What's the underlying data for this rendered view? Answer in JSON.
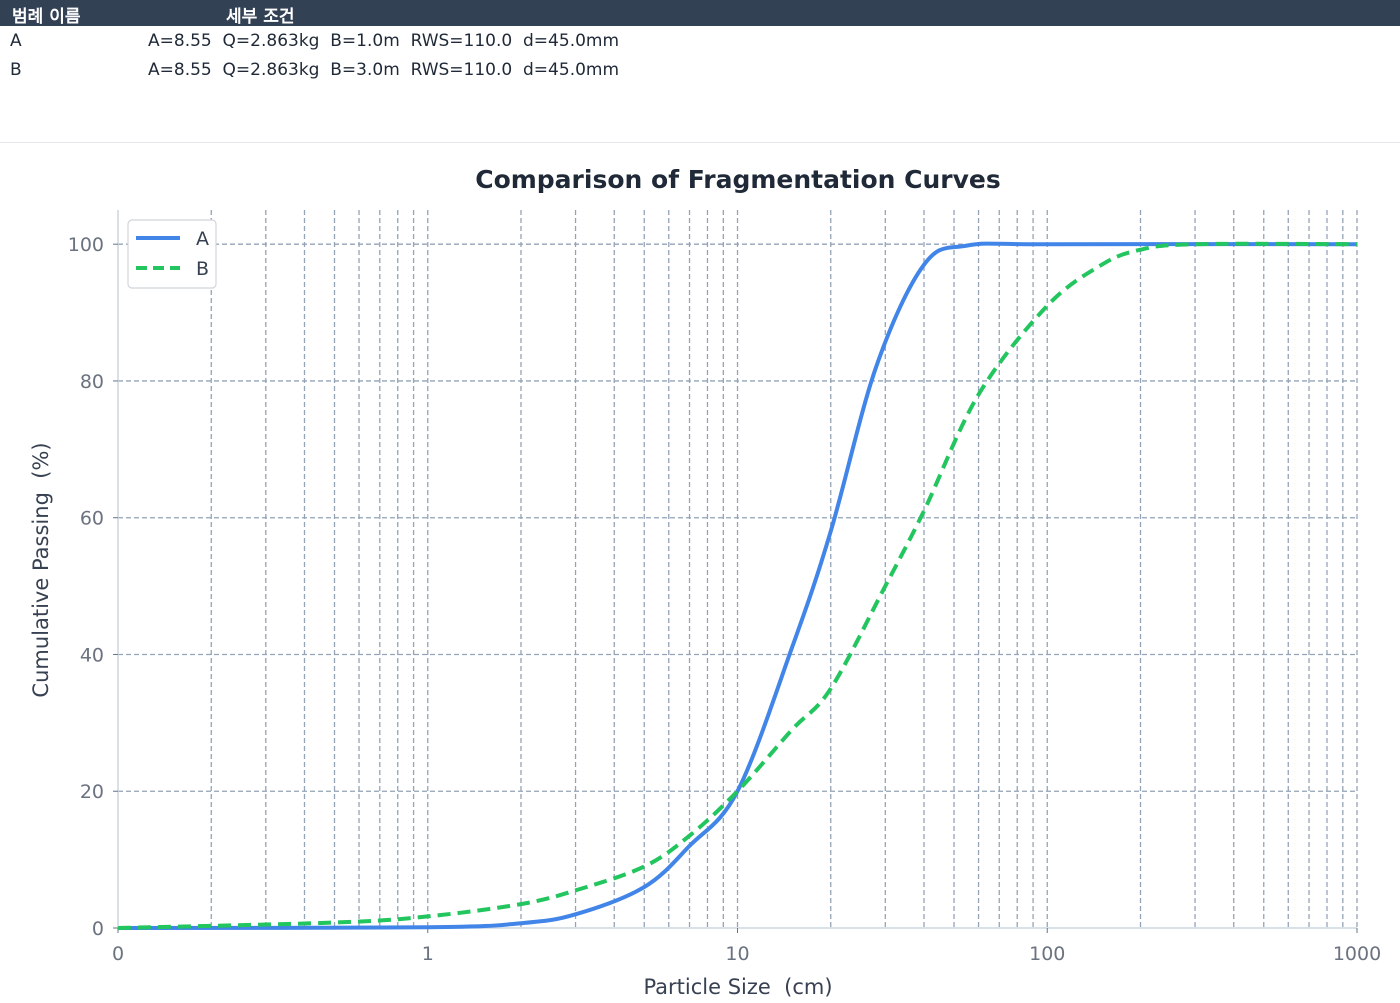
{
  "legend_table": {
    "headers": {
      "name": "범례 이름",
      "details": "세부 조건"
    },
    "rows": [
      {
        "name": "A",
        "details": "A=8.55  Q=2.863kg  B=1.0m  RWS=110.0  d=45.0mm"
      },
      {
        "name": "B",
        "details": "A=8.55  Q=2.863kg  B=3.0m  RWS=110.0  d=45.0mm"
      }
    ]
  },
  "chart_data": {
    "type": "line",
    "title": "Comparison of Fragmentation Curves",
    "xlabel": "Particle Size  (cm)",
    "ylabel": "Cumulative Passing  (%)",
    "xscale": "log",
    "xlim": [
      0.1,
      1000
    ],
    "ylim": [
      0,
      105
    ],
    "x_tick_labels": [
      "0",
      "1",
      "10",
      "100",
      "1000"
    ],
    "y_ticks": [
      0,
      20,
      40,
      60,
      80,
      100
    ],
    "grid": true,
    "legend_position": "top-left",
    "series": [
      {
        "name": "A",
        "color": "#4285e8",
        "style": "solid",
        "x": [
          0.1,
          1,
          2,
          3,
          5,
          7,
          10,
          15,
          20,
          28,
          40,
          55,
          100,
          1000
        ],
        "y": [
          0,
          0.1,
          0.7,
          2,
          6,
          12,
          20,
          41,
          58,
          82,
          97,
          99.8,
          100,
          100
        ]
      },
      {
        "name": "B",
        "color": "#22c55e",
        "style": "dashed",
        "x": [
          0.1,
          0.5,
          1,
          2,
          3,
          5,
          7,
          10,
          15,
          20,
          30,
          40,
          60,
          100,
          150,
          200,
          300,
          1000
        ],
        "y": [
          0,
          0.8,
          1.7,
          3.5,
          5.5,
          9,
          13.5,
          20,
          29,
          35,
          50,
          61,
          78,
          91,
          97,
          99.2,
          100,
          100
        ]
      }
    ]
  }
}
